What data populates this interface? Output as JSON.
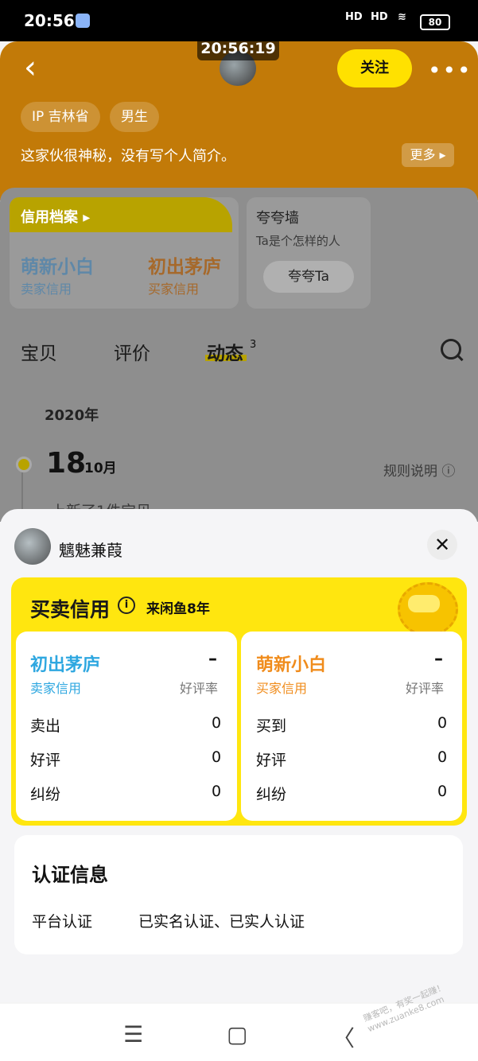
{
  "status_bar": {
    "time": "20:56",
    "signal1": "HD",
    "signal2": "HD",
    "battery": "80"
  },
  "timestamp_badge": "20:56:19",
  "header": {
    "follow_label": "关注",
    "tags": [
      "IP 吉林省",
      "男生"
    ],
    "bio": "这家伙很神秘，没有写个人简介。",
    "more_label": "更多 ▸"
  },
  "background": {
    "credit_title": "信用档案 ▸",
    "seller_level": "萌新小白",
    "seller_caption": "卖家信用",
    "buyer_level": "初出茅庐",
    "buyer_caption": "买家信用",
    "praise_title": "夸夸墙",
    "praise_sub": "Ta是个怎样的人",
    "praise_button": "夸夸Ta",
    "tabs": [
      "宝贝",
      "评价",
      "动态"
    ],
    "tab_badge": "3",
    "year": "2020年",
    "day": "18",
    "month": "10月",
    "rules": "规则说明 ⓘ",
    "partial_text": "上新了1件宝贝"
  },
  "sheet": {
    "username": "魑魅兼葭",
    "close": "✕",
    "credit_title": "买卖信用",
    "info_icon": "i",
    "years": "来闲鱼8年",
    "seller": {
      "level": "初出茅庐",
      "caption": "卖家信用",
      "dash": "–",
      "rate_label": "好评率",
      "rows": [
        {
          "label": "卖出",
          "value": "0"
        },
        {
          "label": "好评",
          "value": "0"
        },
        {
          "label": "纠纷",
          "value": "0"
        }
      ]
    },
    "buyer": {
      "level": "萌新小白",
      "caption": "买家信用",
      "dash": "–",
      "rate_label": "好评率",
      "rows": [
        {
          "label": "买到",
          "value": "0"
        },
        {
          "label": "好评",
          "value": "0"
        },
        {
          "label": "纠纷",
          "value": "0"
        }
      ]
    },
    "cert": {
      "title": "认证信息",
      "label": "平台认证",
      "value": "已实名认证、已实人认证"
    }
  },
  "nav": {
    "menu_icon": "☰",
    "home_icon": "▢",
    "back_icon": "〈"
  },
  "watermark": "赚客吧，有奖一起赚！ www.zuanke8.com",
  "colors": {
    "header": "#c27a08",
    "accent_yellow": "#ffe60f",
    "seller_blue": "#2ea7e0",
    "buyer_orange": "#f08c1c"
  }
}
